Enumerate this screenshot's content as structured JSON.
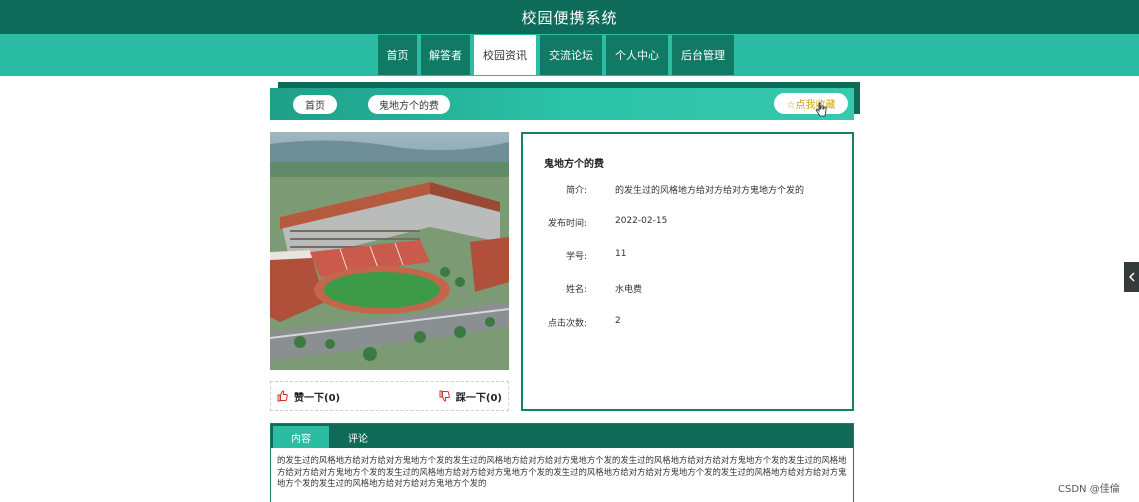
{
  "header": {
    "title": "校园便携系统"
  },
  "nav": {
    "items": [
      {
        "label": "首页",
        "active": false,
        "width": 39
      },
      {
        "label": "解答者",
        "active": false,
        "width": 49
      },
      {
        "label": "校园资讯",
        "active": true,
        "width": 62
      },
      {
        "label": "交流论坛",
        "active": false,
        "width": 62
      },
      {
        "label": "个人中心",
        "active": false,
        "width": 62
      },
      {
        "label": "后台管理",
        "active": false,
        "width": 62
      }
    ]
  },
  "breadcrumb": {
    "home": "首页",
    "current": "鬼地方个的费"
  },
  "favorite": {
    "label": "☆点我收藏"
  },
  "votes": {
    "like": "赞一下(0)",
    "dislike": "踩一下(0)"
  },
  "detail": {
    "title": "鬼地方个的费",
    "fields": [
      {
        "label": "简介:",
        "value": "的发生过的风格地方给对方给对方鬼地方个发的"
      },
      {
        "label": "发布时间:",
        "value": "2022-02-15"
      },
      {
        "label": "学号:",
        "value": "11"
      },
      {
        "label": "姓名:",
        "value": "水电费"
      },
      {
        "label": "点击次数:",
        "value": "2"
      }
    ]
  },
  "tabs": {
    "content": "内容",
    "comments": "评论"
  },
  "content": {
    "text": "的发生过的风格地方给对方给对方鬼地方个发的发生过的风格地方给对方给对方鬼地方个发的发生过的风格地方给对方给对方鬼地方个发的发生过的风格地方给对方给对方鬼地方个发的发生过的风格地方给对方给对方鬼地方个发的发生过的风格地方给对方给对方鬼地方个发的发生过的风格地方给对方给对方鬼地方个发的发生过的风格地方给对方给对方鬼地方个发的"
  },
  "watermark": "CSDN @佳倫",
  "colors": {
    "dark_green": "#0e6b59",
    "teal": "#2bbda4",
    "accent": "#17806b"
  }
}
